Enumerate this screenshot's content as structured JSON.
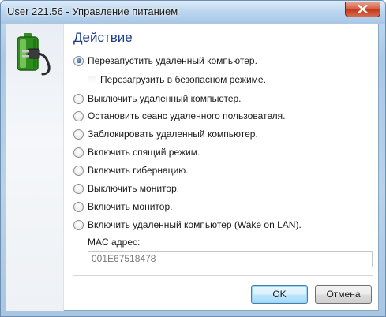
{
  "window": {
    "title": "User 221.56 - Управление питанием"
  },
  "section": {
    "title": "Действие"
  },
  "options": [
    {
      "label": "Перезапустить удаленный компьютер.",
      "checked": true
    },
    {
      "label": "Выключить удаленный компьютер.",
      "checked": false
    },
    {
      "label": "Остановить сеанс удаленного пользователя.",
      "checked": false
    },
    {
      "label": "Заблокировать удаленный компьютер.",
      "checked": false
    },
    {
      "label": "Включить спящий режим.",
      "checked": false
    },
    {
      "label": "Включить гибернацию.",
      "checked": false
    },
    {
      "label": "Выключить монитор.",
      "checked": false
    },
    {
      "label": "Включить монитор.",
      "checked": false
    },
    {
      "label": "Включить удаленный компьютер (Wake on LAN).",
      "checked": false
    }
  ],
  "safe_mode": {
    "label": "Перезагрузить в безопасном режиме.",
    "checked": false
  },
  "mac": {
    "label": "MAC адрес:",
    "value": "001E67518478"
  },
  "buttons": {
    "ok": "OK",
    "cancel": "Отмена"
  },
  "colors": {
    "section_title": "#1e3c8c",
    "close_button": "#c4391c",
    "default_button_border": "#3c7fb1"
  }
}
